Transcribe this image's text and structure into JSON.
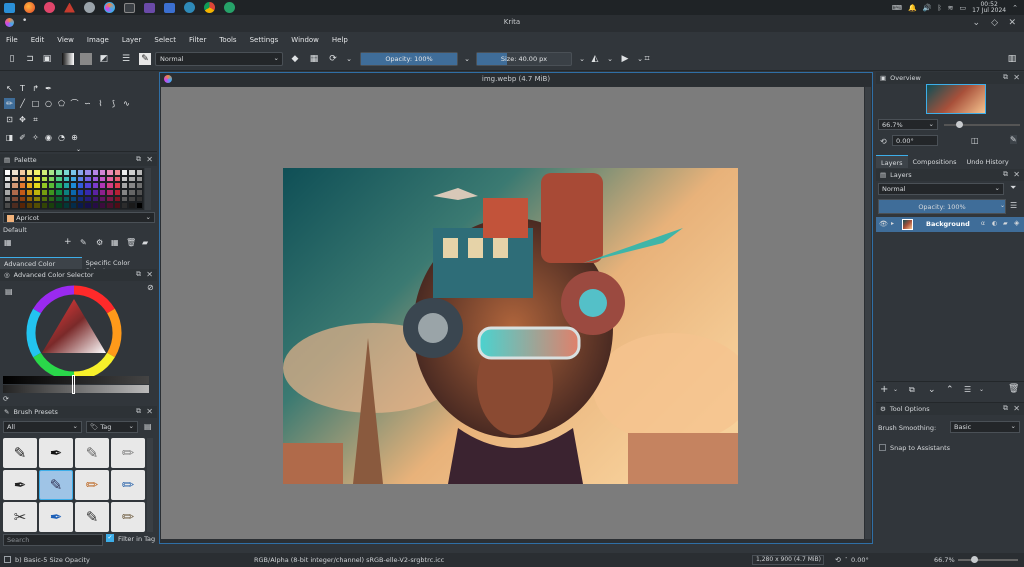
{
  "taskbar": {
    "clock_time": "00:52",
    "clock_date": "17 Jul 2024",
    "tray_icons": [
      "keyboard-icon",
      "bell-icon",
      "volume-icon",
      "bluetooth-icon",
      "wifi-icon",
      "battery-icon",
      "chevron-up-icon"
    ]
  },
  "window": {
    "title": "Krita"
  },
  "menubar": {
    "items": [
      "File",
      "Edit",
      "View",
      "Image",
      "Layer",
      "Select",
      "Filter",
      "Tools",
      "Settings",
      "Window",
      "Help"
    ]
  },
  "toolbar": {
    "blend_mode": "Normal",
    "opacity_label": "Opacity: 100%",
    "opacity_value": 1.0,
    "size_label": "Size: 40.00 px",
    "size_fill": 0.32
  },
  "palette": {
    "title": "Palette",
    "selected_color_name": "Apricot",
    "palette_name": "Default",
    "colors": [
      "#ffffff",
      "#f0e3d0",
      "#f3c9a0",
      "#f6e48a",
      "#f3f36a",
      "#d0ee78",
      "#a7e78a",
      "#7fe1a8",
      "#7ad9d3",
      "#7ac5eb",
      "#88a6ef",
      "#9b8cec",
      "#b786e6",
      "#d485d7",
      "#eb8bb8",
      "#f08a96",
      "#eeeeee",
      "#d0d0d0",
      "#b8b8b8",
      "#e8e8e8",
      "#e6bfa0",
      "#ee9c60",
      "#f1c84c",
      "#efe838",
      "#b2df48",
      "#7fd45f",
      "#4ccc85",
      "#43c2bf",
      "#3fa9e4",
      "#5a7fe8",
      "#7561e4",
      "#9a57dc",
      "#c558c8",
      "#e3609e",
      "#ea5e70",
      "#c9c9c9",
      "#a9a9a9",
      "#909090",
      "#c8c8c8",
      "#d39874",
      "#e47a2e",
      "#e9ad1c",
      "#e3d91b",
      "#93c924",
      "#5abb36",
      "#26b25f",
      "#1fa6a2",
      "#1c8bd6",
      "#325ddc",
      "#5242d8",
      "#7c3bcc",
      "#b037b4",
      "#d43f84",
      "#e03a4d",
      "#a7a7a7",
      "#878787",
      "#707070",
      "#a8a8a8",
      "#b06b4c",
      "#c35a18",
      "#c78b0c",
      "#bfb50c",
      "#749d10",
      "#3d941f",
      "#0f8a43",
      "#0c8180",
      "#0b68ad",
      "#1d3fb3",
      "#3628ae",
      "#5b22a3",
      "#8c208d",
      "#ad2566",
      "#b81f33",
      "#858585",
      "#666666",
      "#525252",
      "#7a7a7a",
      "#7d4935",
      "#8c3e0e",
      "#8e6206",
      "#878006",
      "#526f0a",
      "#2a6816",
      "#09612f",
      "#075b5a",
      "#07497a",
      "#122c7e",
      "#251b7a",
      "#3f1672",
      "#621563",
      "#7a1847",
      "#811424",
      "#5e5e5e",
      "#444444",
      "#333333",
      "#4a4a4a",
      "#4d2c20",
      "#562507",
      "#573c03",
      "#534e03",
      "#324405",
      "#193f0c",
      "#043b1c",
      "#043737",
      "#042c4a",
      "#0a1a4d",
      "#16104a",
      "#260d45",
      "#3b0c3c",
      "#4a0e2b",
      "#4f0c16",
      "#2c2c2c",
      "#1a1a1a",
      "#000000"
    ]
  },
  "color_selector": {
    "tab_advanced": "Advanced Color Selector",
    "tab_specific": "Specific Color Selector",
    "title": "Advanced Color Selector"
  },
  "brush_presets": {
    "title": "Brush Presets",
    "filter_all": "All",
    "tag_label": "Tag",
    "search_placeholder": "Search",
    "filter_in_tag": "Filter in Tag"
  },
  "canvas": {
    "tab_title": "img.webp (4.7 MiB)"
  },
  "overview": {
    "title": "Overview",
    "zoom": "66.7%",
    "rotation": "0.00°"
  },
  "layers_tabs": [
    "Layers",
    "Compositions",
    "Undo History"
  ],
  "layers": {
    "title": "Layers",
    "blend_mode": "Normal",
    "opacity_label": "Opacity: 100%",
    "items": [
      {
        "name": "Background"
      }
    ]
  },
  "tool_options": {
    "title": "Tool Options",
    "brush_smoothing_label": "Brush Smoothing:",
    "brush_smoothing_value": "Basic",
    "snap_label": "Snap to Assistants"
  },
  "statusbar": {
    "brush": "b) Basic-5 Size Opacity",
    "color_info": "RGB/Alpha (8-bit integer/channel)  sRGB-elle-V2-srgbtrc.icc",
    "image_size": "1,280 x 900 (4.7 MiB)",
    "rotation": "0.00°",
    "zoom": "66.7%"
  },
  "colors": {
    "accent": "#3daee9",
    "selection": "#3f6d99",
    "bg": "#31363b"
  }
}
